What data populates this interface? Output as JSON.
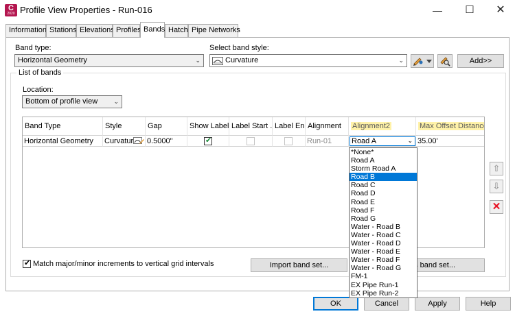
{
  "window": {
    "icon_letter": "C",
    "icon_sub": "2020",
    "title": "Profile View Properties - Run-016",
    "minimize_glyph": "—",
    "maximize_glyph": "☐",
    "close_glyph": "✕"
  },
  "tabs": [
    "Information",
    "Stations",
    "Elevations",
    "Profiles",
    "Bands",
    "Hatch",
    "Pipe Networks"
  ],
  "active_tab": "Bands",
  "band_type": {
    "label": "Band type:",
    "value": "Horizontal Geometry"
  },
  "band_style": {
    "label": "Select band style:",
    "value": "Curvature"
  },
  "add_button": "Add>>",
  "list_of_bands_label": "List of bands",
  "location": {
    "label": "Location:",
    "value": "Bottom of profile view"
  },
  "grid": {
    "columns": [
      "Band Type",
      "Style",
      "Gap",
      "Show Labels",
      "Label Start ...",
      "Label En...",
      "Alignment",
      "Alignment2",
      "Max Offset Distance"
    ],
    "highlighted_columns": [
      "Alignment2",
      "Max Offset Distance"
    ],
    "row": {
      "band_type": "Horizontal Geometry",
      "style": "Curvature",
      "gap": "0.5000\"",
      "show_labels_checked": true,
      "alignment": "Run-01",
      "alignment2": "Road A",
      "max_offset": "35.00'"
    }
  },
  "dropdown_options": [
    "*None*",
    "Road A",
    "Storm Road A",
    "Road B",
    "Road C",
    "Road D",
    "Road E",
    "Road F",
    "Road G",
    "Water - Road B",
    "Water - Road C",
    "Water - Road D",
    "Water - Road E",
    "Water - Road F",
    "Water - Road G",
    "FM-1",
    "EX Pipe Run-1",
    "EX Pipe Run-2"
  ],
  "dropdown_selected": "Road B",
  "match_checkbox": {
    "label": "Match major/minor increments to vertical grid intervals",
    "checked": true
  },
  "import_button": "Import band set...",
  "save_button": "as band set...",
  "footer": {
    "ok": "OK",
    "cancel": "Cancel",
    "apply": "Apply",
    "help": "Help"
  },
  "colors": {
    "accent": "#0078d7",
    "highlight": "#fff2a8",
    "delete": "#e81123",
    "app_icon": "#b4164f"
  }
}
